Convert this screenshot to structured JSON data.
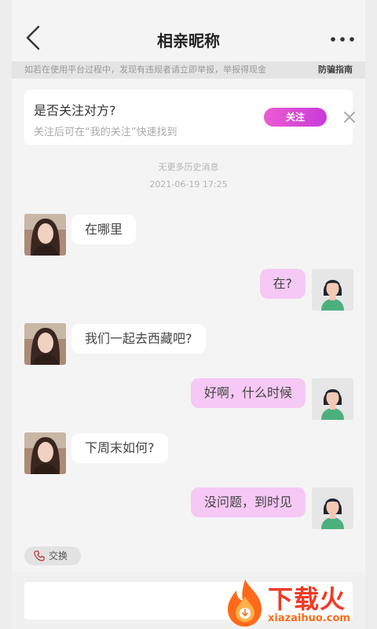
{
  "header": {
    "title": "相亲昵称",
    "back_icon": "chevron-left-icon",
    "more_icon": "more-dots-icon"
  },
  "warning": {
    "text": "如若在使用平台过程中，发现有违规者请立即举报，举报得现金",
    "link": "防骗指南"
  },
  "follow_card": {
    "title": "是否关注对方?",
    "subtitle": "关注后可在“我的关注”快速找到",
    "button": "关注",
    "close_icon": "close-icon"
  },
  "history": {
    "no_more": "无更多历史消息",
    "timestamp": "2021-06-19 17:25"
  },
  "messages": [
    {
      "side": "left",
      "text": "在哪里"
    },
    {
      "side": "right",
      "text": "在?"
    },
    {
      "side": "left",
      "text": "我们一起去西藏吧?"
    },
    {
      "side": "right",
      "text": "好啊，什么时候"
    },
    {
      "side": "left",
      "text": "下周末如何?"
    },
    {
      "side": "right",
      "text": "没问题，到时见"
    }
  ],
  "exchange": {
    "label": "交换",
    "icon": "phone-icon"
  },
  "input": {
    "placeholder": ""
  },
  "watermark": {
    "text": "下载火",
    "url": "xiazaihuo.com"
  },
  "colors": {
    "accent": "#d94ad8",
    "bubble_self": "#f6c8f5",
    "bubble_other": "#ffffff",
    "watermark": "#f03a25"
  }
}
